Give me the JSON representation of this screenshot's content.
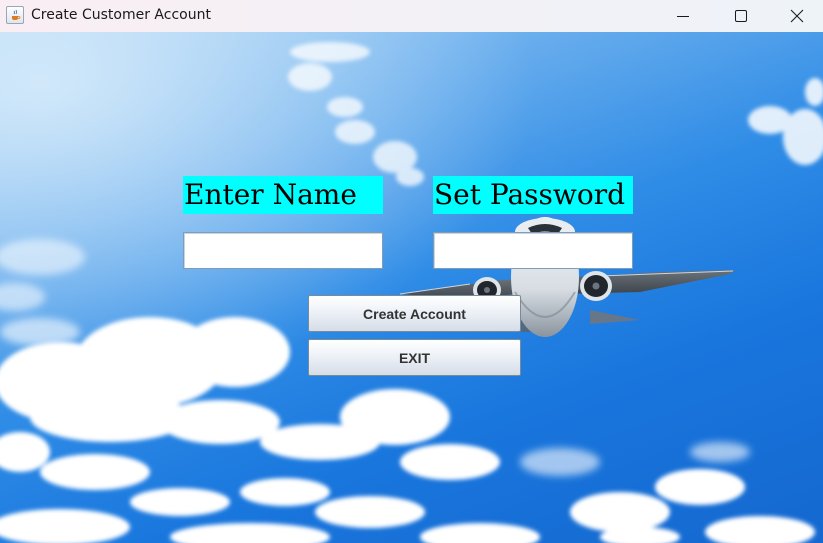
{
  "window": {
    "title": "Create Customer Account",
    "controls": {
      "minimize": "minimize-icon",
      "maximize": "maximize-icon",
      "close": "close-icon"
    }
  },
  "form": {
    "name_label": "Enter Name",
    "password_label": "Set Password",
    "name_value": "",
    "password_value": "",
    "create_button": "Create Account",
    "exit_button": "EXIT"
  },
  "colors": {
    "label_background": "#00ffff",
    "sky": "#1976dd"
  },
  "background": {
    "image": "sky-with-clouds-and-airplane"
  }
}
